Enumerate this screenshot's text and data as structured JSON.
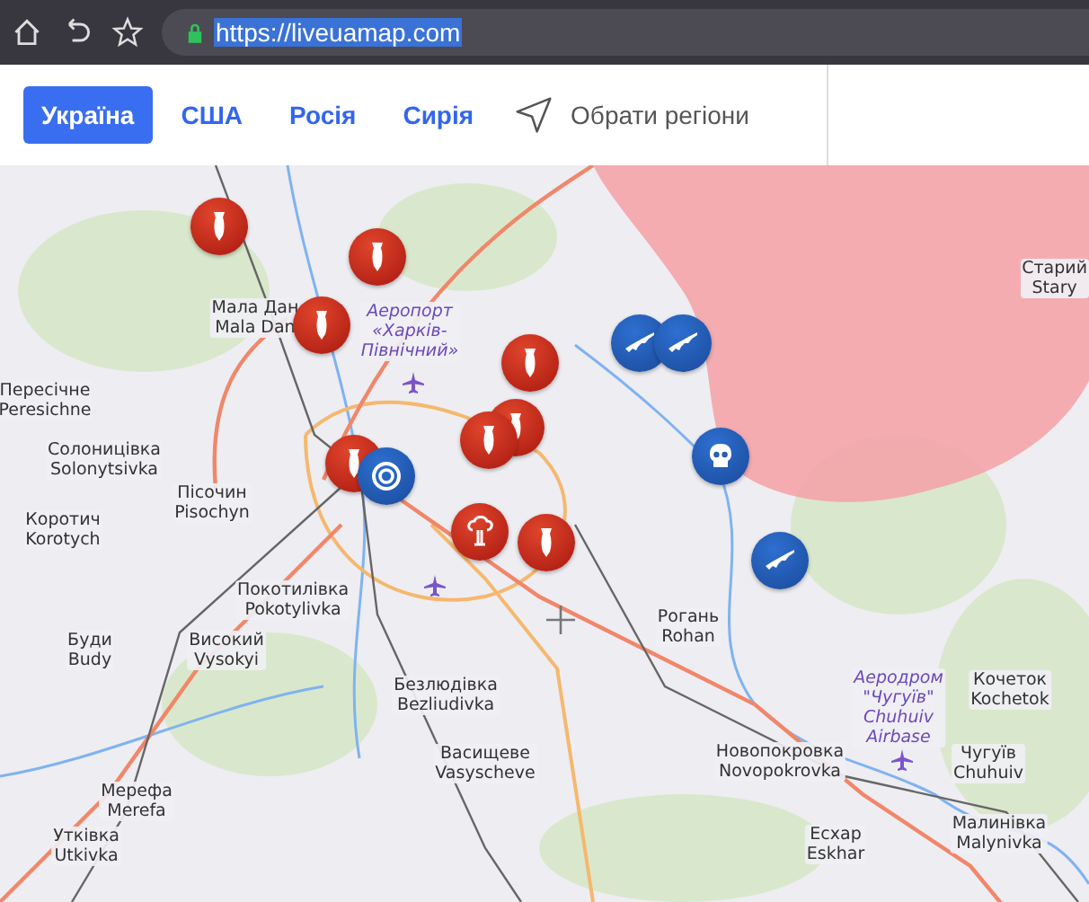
{
  "browser": {
    "url": "https://liveuamap.com"
  },
  "nav": {
    "tabs": [
      {
        "label": "Україна",
        "selected": true
      },
      {
        "label": "США",
        "selected": false
      },
      {
        "label": "Росія",
        "selected": false
      },
      {
        "label": "Сирія",
        "selected": false
      }
    ],
    "region_button": "Обрати регіони"
  },
  "map": {
    "places": [
      {
        "kind": "town",
        "lines": [
          "Мала Дан",
          "Mala Dan"
        ]
      },
      {
        "kind": "town",
        "lines": [
          "Пересічне",
          "Peresichne"
        ]
      },
      {
        "kind": "town",
        "lines": [
          "Солоницівка",
          "Solonytsivka"
        ]
      },
      {
        "kind": "town",
        "lines": [
          "Пісочин",
          "Pisochyn"
        ]
      },
      {
        "kind": "town",
        "lines": [
          "Коротич",
          "Korotych"
        ]
      },
      {
        "kind": "town",
        "lines": [
          "Покотилівка",
          "Pokotylivka"
        ]
      },
      {
        "kind": "town",
        "lines": [
          "Буди",
          "Budy"
        ]
      },
      {
        "kind": "town",
        "lines": [
          "Високий",
          "Vysokyi"
        ]
      },
      {
        "kind": "town",
        "lines": [
          "Безлюдівка",
          "Bezliudivka"
        ]
      },
      {
        "kind": "town",
        "lines": [
          "Васищеве",
          "Vasyscheve"
        ]
      },
      {
        "kind": "town",
        "lines": [
          "Мерефа",
          "Merefa"
        ]
      },
      {
        "kind": "town",
        "lines": [
          "Утківка",
          "Utkivka"
        ]
      },
      {
        "kind": "town",
        "lines": [
          "Рогань",
          "Rohan"
        ]
      },
      {
        "kind": "town",
        "lines": [
          "Новопокровка",
          "Novopokrovka"
        ]
      },
      {
        "kind": "town",
        "lines": [
          "Есхар",
          "Eskhar"
        ]
      },
      {
        "kind": "town",
        "lines": [
          "Кочеток",
          "Kochetok"
        ]
      },
      {
        "kind": "town",
        "lines": [
          "Чугуїв",
          "Chuhuiv"
        ]
      },
      {
        "kind": "town",
        "lines": [
          "Малинівка",
          "Malynivka"
        ]
      },
      {
        "kind": "town",
        "lines": [
          "Старий",
          "Stary"
        ]
      },
      {
        "kind": "airport",
        "lines": [
          "Аеропорт",
          "«Харків-",
          "Північний»"
        ]
      },
      {
        "kind": "airport",
        "lines": [
          "Аеродром",
          "\"Чугуїв\"",
          "Chuhuiv",
          "Airbase"
        ]
      }
    ],
    "markers": [
      {
        "kind": "bomb"
      },
      {
        "kind": "bomb"
      },
      {
        "kind": "bomb"
      },
      {
        "kind": "bomb"
      },
      {
        "kind": "bomb"
      },
      {
        "kind": "bomb"
      },
      {
        "kind": "bomb"
      },
      {
        "kind": "bomb"
      },
      {
        "kind": "lifebuoy"
      },
      {
        "kind": "explosion"
      },
      {
        "kind": "rifle"
      },
      {
        "kind": "rifle"
      },
      {
        "kind": "rifle"
      },
      {
        "kind": "skull"
      }
    ]
  }
}
